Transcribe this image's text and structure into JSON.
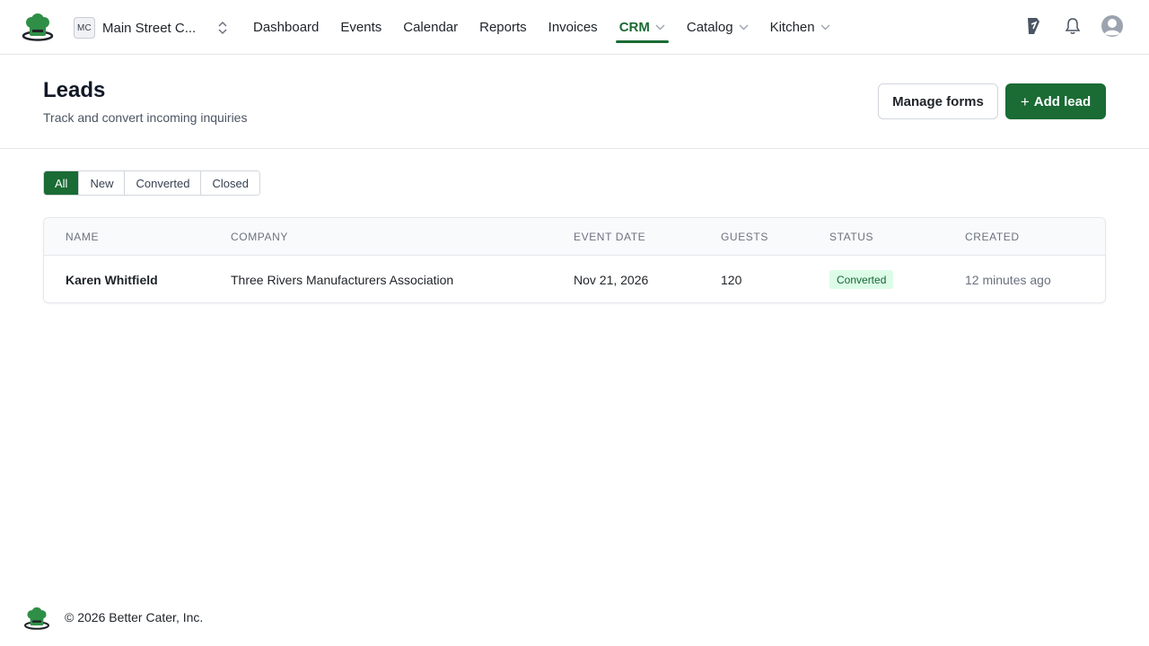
{
  "brand": {
    "logo_icon": "chef-hat-logo-icon",
    "accent_color": "#1a6b34"
  },
  "org": {
    "initials": "MC",
    "name": "Main Street C...",
    "switch_icon": "chevron-up-down-icon"
  },
  "nav": {
    "items": [
      {
        "label": "Dashboard",
        "active": false,
        "has_dropdown": false
      },
      {
        "label": "Events",
        "active": false,
        "has_dropdown": false
      },
      {
        "label": "Calendar",
        "active": false,
        "has_dropdown": false
      },
      {
        "label": "Reports",
        "active": false,
        "has_dropdown": false
      },
      {
        "label": "Invoices",
        "active": false,
        "has_dropdown": false
      },
      {
        "label": "CRM",
        "active": true,
        "has_dropdown": true
      },
      {
        "label": "Catalog",
        "active": false,
        "has_dropdown": true
      },
      {
        "label": "Kitchen",
        "active": false,
        "has_dropdown": true
      }
    ]
  },
  "top_right": {
    "icons": [
      "announcement-icon",
      "bell-icon",
      "user-avatar-icon"
    ]
  },
  "header": {
    "title": "Leads",
    "subtitle": "Track and convert incoming inquiries",
    "manage_forms_label": "Manage forms",
    "add_lead_label": "Add lead",
    "add_lead_icon": "plus-icon"
  },
  "filters": {
    "tabs": [
      {
        "label": "All",
        "active": true
      },
      {
        "label": "New",
        "active": false
      },
      {
        "label": "Converted",
        "active": false
      },
      {
        "label": "Closed",
        "active": false
      }
    ]
  },
  "table": {
    "columns": [
      "NAME",
      "COMPANY",
      "EVENT DATE",
      "GUESTS",
      "STATUS",
      "CREATED"
    ],
    "rows": [
      {
        "name": "Karen Whitfield",
        "company": "Three Rivers Manufacturers Association",
        "event_date": "Nov 21, 2026",
        "guests": "120",
        "status": "Converted",
        "created": "12 minutes ago"
      }
    ],
    "status_colors": {
      "Converted": "#dcfce7"
    }
  },
  "footer": {
    "copyright": "© 2026 Better Cater, Inc."
  }
}
